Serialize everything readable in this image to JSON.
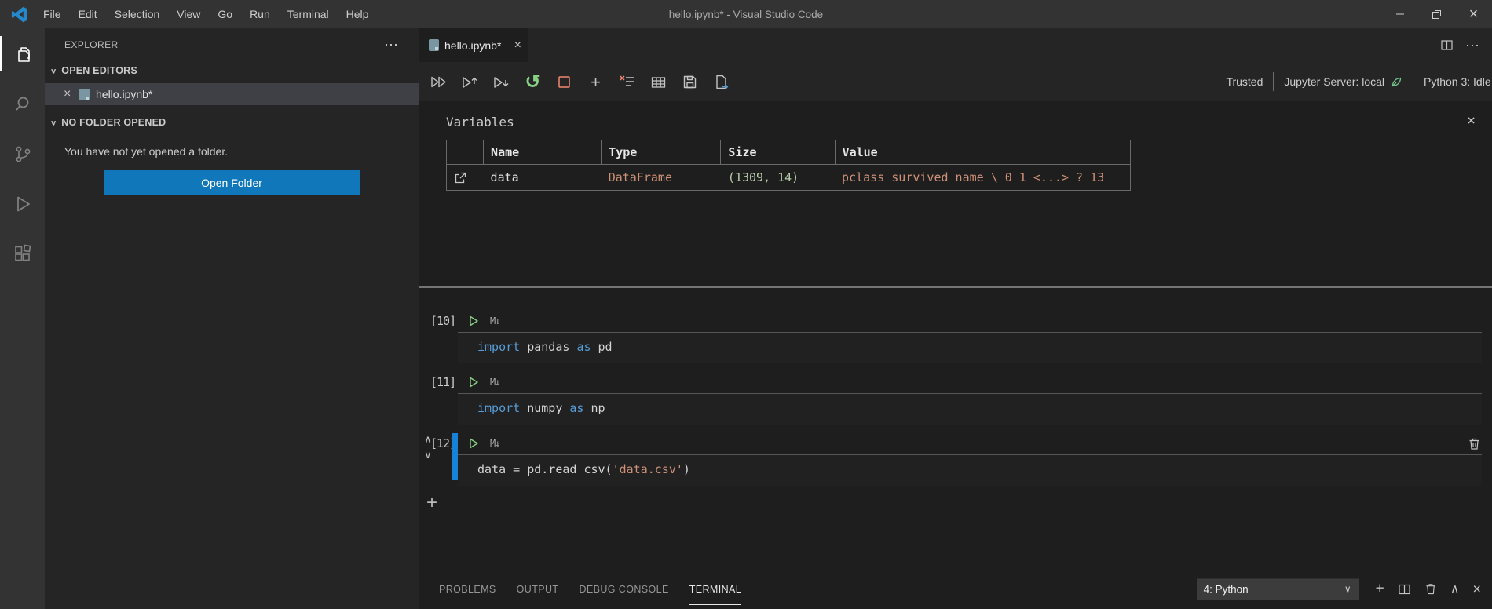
{
  "titlebar": {
    "menus": [
      "File",
      "Edit",
      "Selection",
      "View",
      "Go",
      "Run",
      "Terminal",
      "Help"
    ],
    "title": "hello.ipynb* - Visual Studio Code"
  },
  "sidebar": {
    "title": "EXPLORER",
    "open_editors_label": "OPEN EDITORS",
    "open_editor_item": "hello.ipynb*",
    "no_folder_label": "NO FOLDER OPENED",
    "empty_message": "You have not yet opened a folder.",
    "open_folder_button": "Open Folder"
  },
  "editor": {
    "tab_label": "hello.ipynb*",
    "status": {
      "trusted": "Trusted",
      "jupyter": "Jupyter Server: local",
      "kernel": "Python 3: Idle"
    },
    "variables": {
      "title": "Variables",
      "columns": {
        "name": "Name",
        "type": "Type",
        "size": "Size",
        "value": "Value"
      },
      "row": {
        "name": "data",
        "type": "DataFrame",
        "size": "(1309, 14)",
        "value": "pclass survived name \\ 0 1 <...> ? 13"
      }
    },
    "cells": [
      {
        "count": "[10]",
        "lang": "M↓",
        "tokens": {
          "kw1": "import",
          "t1": " pandas ",
          "kw2": "as",
          "t2": " pd"
        }
      },
      {
        "count": "[11]",
        "lang": "M↓",
        "tokens": {
          "kw1": "import",
          "t1": " numpy ",
          "kw2": "as",
          "t2": " np"
        }
      },
      {
        "count": "[12]",
        "lang": "M↓",
        "tokens": {
          "t1": "data = pd.read_csv(",
          "str": "'data.csv'",
          "t2": ")"
        }
      }
    ]
  },
  "panel": {
    "tabs": [
      "PROBLEMS",
      "OUTPUT",
      "DEBUG CONSOLE",
      "TERMINAL"
    ],
    "active_tab": "TERMINAL",
    "terminal_select": "4: Python"
  },
  "icons": {
    "close": "×",
    "ellipsis": "⋯",
    "chevron_down": "∨",
    "chevron_up": "∧",
    "plus": "+",
    "restart": "↺"
  },
  "colors": {
    "accent_blue": "#1683d8",
    "button_blue": "#1177bb",
    "keyword": "#569cd6",
    "string": "#ce9178",
    "size_green": "#b5cea8",
    "run_green": "#89d185",
    "stop_red": "#f48771"
  }
}
